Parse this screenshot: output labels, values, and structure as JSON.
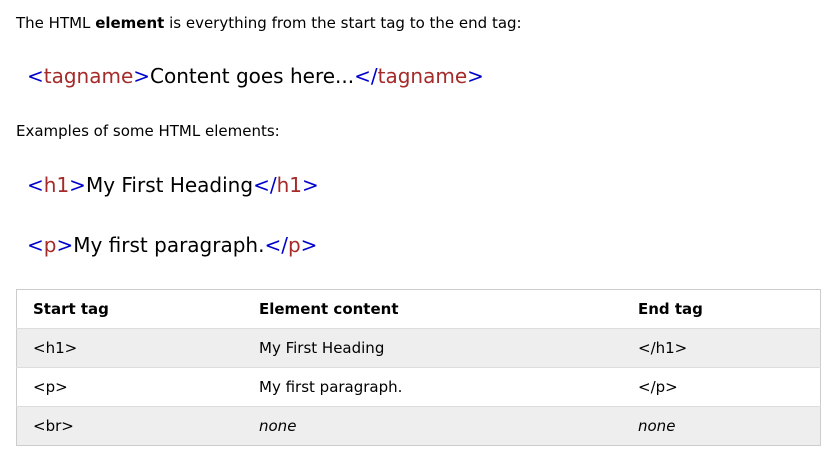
{
  "intro": {
    "before": "The HTML ",
    "bold": "element",
    "after": " is everything from the start tag to the end tag:"
  },
  "syntax": {
    "open_lt": "<",
    "open_name": "tagname",
    "open_gt": ">",
    "content": "Content goes here...",
    "close_lt": "</",
    "close_name": "tagname",
    "close_gt": ">"
  },
  "examples_label": "Examples of some HTML elements:",
  "example_h1": {
    "open_lt": "<",
    "open_name": "h1",
    "open_gt": ">",
    "content": "My First Heading",
    "close_lt": "</",
    "close_name": "h1",
    "close_gt": ">"
  },
  "example_p": {
    "open_lt": "<",
    "open_name": "p",
    "open_gt": ">",
    "content": "My first paragraph.",
    "close_lt": "</",
    "close_name": "p",
    "close_gt": ">"
  },
  "table": {
    "headers": [
      "Start tag",
      "Element content",
      "End tag"
    ],
    "rows": [
      [
        "<h1>",
        "My First Heading",
        "</h1>"
      ],
      [
        "<p>",
        "My first paragraph.",
        "</p>"
      ],
      [
        "<br>",
        "none",
        "none"
      ]
    ]
  },
  "colors": {
    "bracket": "#0000cd",
    "tagname": "#a52a2a",
    "row_stripe": "#eeeeee",
    "border": "#cccccc"
  }
}
